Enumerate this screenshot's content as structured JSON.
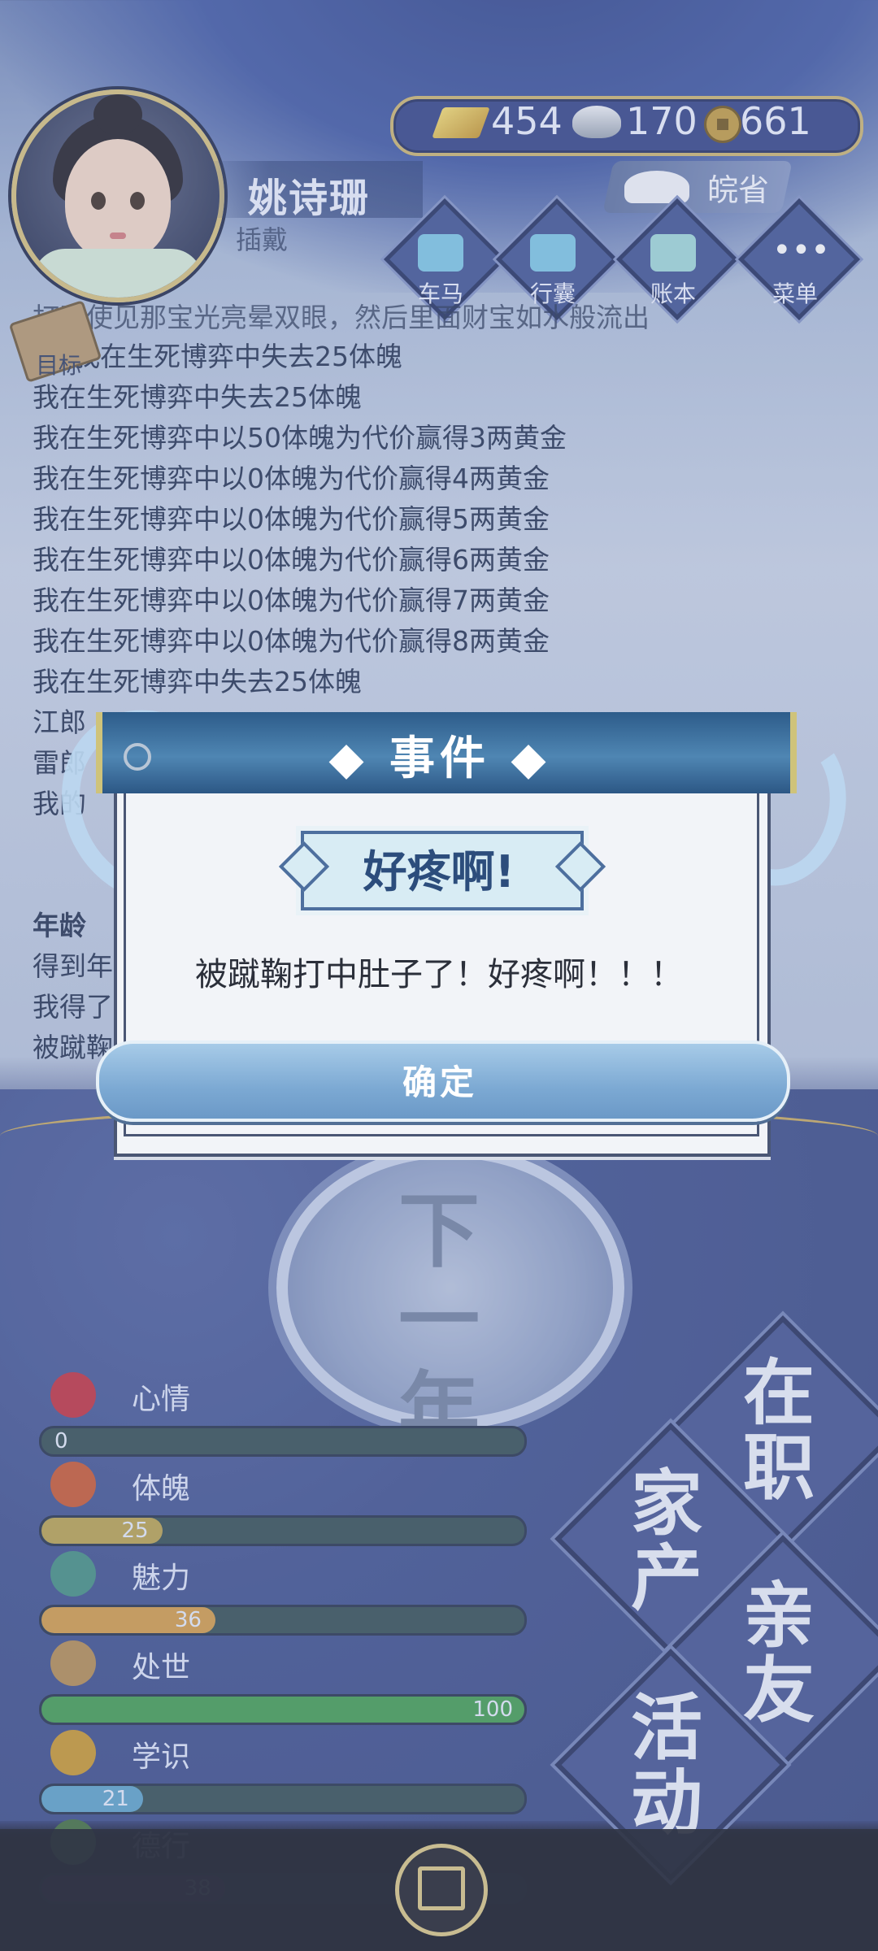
{
  "player": {
    "name": "姚诗珊",
    "title": "插戴"
  },
  "resources": [
    {
      "icon": "gold-ingot-icon",
      "value": "454"
    },
    {
      "icon": "silver-ingot-icon",
      "value": "170"
    },
    {
      "icon": "copper-coin-icon",
      "value": "661"
    }
  ],
  "location": "皖省",
  "toolbar": [
    {
      "label": "车马",
      "icon": "carriage-icon"
    },
    {
      "label": "行囊",
      "icon": "bag-icon"
    },
    {
      "label": "账本",
      "icon": "ledger-icon"
    },
    {
      "label": "菜单",
      "icon": "menu-icon"
    }
  ],
  "target_label": "目标",
  "log": [
    "打开使见那宝光亮晕双眼，然后里面财宝如水般流出",
    "我在生死博弈中失去25体魄",
    "我在生死博弈中失去25体魄",
    "我在生死博弈中以50体魄为代价赢得3两黄金",
    "我在生死博弈中以0体魄为代价赢得4两黄金",
    "我在生死博弈中以0体魄为代价赢得5两黄金",
    "我在生死博弈中以0体魄为代价赢得6两黄金",
    "我在生死博弈中以0体魄为代价赢得7两黄金",
    "我在生死博弈中以0体魄为代价赢得8两黄金",
    "我在生死博弈中失去25体魄",
    "江郎",
    "雷郎",
    "我的",
    "年龄",
    "得到年",
    "我得了",
    "被蹴鞠"
  ],
  "modal": {
    "title": "事件",
    "event_name": "好疼啊!",
    "message": "被蹴鞠打中肚子了！好疼啊！！！",
    "confirm_label": "确定"
  },
  "next_year_label": "下一年",
  "stats": [
    {
      "label": "心情",
      "value": 0,
      "max": 100,
      "color": "#2f4a4f",
      "icon": "flower-icon",
      "icon_color": "#c02c3b"
    },
    {
      "label": "体魄",
      "value": 25,
      "max": 100,
      "color": "#b9a04a",
      "icon": "drum-icon",
      "icon_color": "#c8552c"
    },
    {
      "label": "魅力",
      "value": 36,
      "max": 100,
      "color": "#d39a43",
      "icon": "mirror-icon",
      "icon_color": "#3f8c7f"
    },
    {
      "label": "处世",
      "value": 100,
      "max": 100,
      "color": "#3e9b4c",
      "icon": "fan-icon",
      "icon_color": "#b38a4e"
    },
    {
      "label": "学识",
      "value": 21,
      "max": 100,
      "color": "#5aa0c8",
      "icon": "books-icon",
      "icon_color": "#c9962a"
    },
    {
      "label": "德行",
      "value": 38,
      "max": 100,
      "color": "#6e2a66",
      "icon": "pipa-icon",
      "icon_color": "#3e6b3a"
    }
  ],
  "categories": [
    "在职",
    "家产",
    "亲友",
    "活动"
  ],
  "share_icon": "share-icon"
}
